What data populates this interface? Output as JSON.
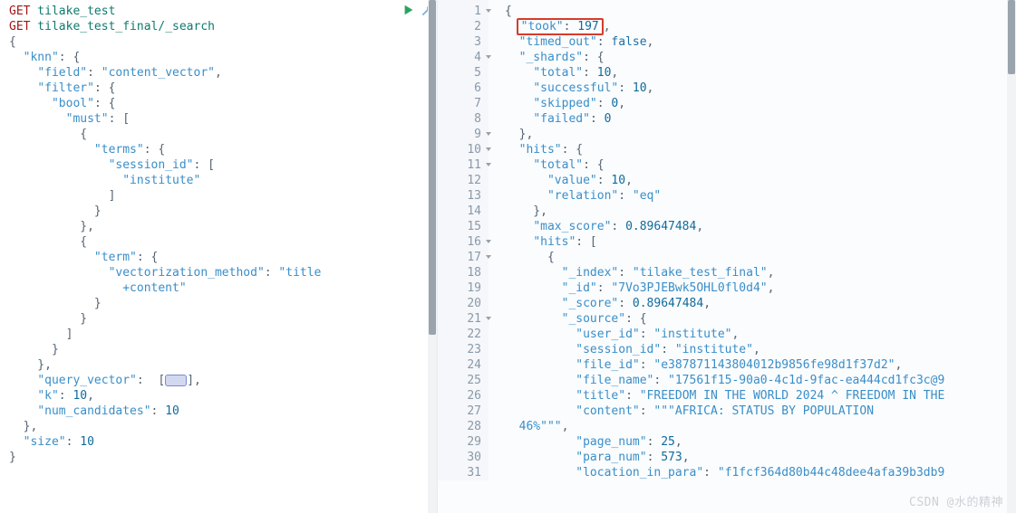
{
  "left": {
    "icons": {
      "play": "play-icon",
      "wrench": "wrench-icon"
    },
    "lines": [
      {
        "t": [
          [
            "GET",
            "m"
          ],
          [
            " tilake_test",
            "k"
          ]
        ]
      },
      {
        "t": [
          [
            "GET",
            "m"
          ],
          [
            " tilake_test_final/_search",
            "k"
          ]
        ]
      },
      {
        "t": [
          [
            "{",
            "p"
          ]
        ]
      },
      {
        "t": [
          [
            "  ",
            "p"
          ],
          [
            "\"knn\"",
            "s"
          ],
          [
            ": {",
            "p"
          ]
        ]
      },
      {
        "t": [
          [
            "    ",
            "p"
          ],
          [
            "\"field\"",
            "s"
          ],
          [
            ": ",
            "p"
          ],
          [
            "\"content_vector\"",
            "s"
          ],
          [
            ",",
            "p"
          ]
        ]
      },
      {
        "t": [
          [
            "    ",
            "p"
          ],
          [
            "\"filter\"",
            "s"
          ],
          [
            ": {",
            "p"
          ]
        ]
      },
      {
        "t": [
          [
            "      ",
            "p"
          ],
          [
            "\"bool\"",
            "s"
          ],
          [
            ": {",
            "p"
          ]
        ]
      },
      {
        "t": [
          [
            "        ",
            "p"
          ],
          [
            "\"must\"",
            "s"
          ],
          [
            ": [",
            "p"
          ]
        ]
      },
      {
        "t": [
          [
            "          {",
            "p"
          ]
        ]
      },
      {
        "t": [
          [
            "            ",
            "p"
          ],
          [
            "\"terms\"",
            "s"
          ],
          [
            ": {",
            "p"
          ]
        ]
      },
      {
        "t": [
          [
            "              ",
            "p"
          ],
          [
            "\"session_id\"",
            "s"
          ],
          [
            ": [",
            "p"
          ]
        ]
      },
      {
        "t": [
          [
            "                ",
            "p"
          ],
          [
            "\"institute\"",
            "s"
          ]
        ]
      },
      {
        "t": [
          [
            "              ]",
            "p"
          ]
        ]
      },
      {
        "t": [
          [
            "            }",
            "p"
          ]
        ]
      },
      {
        "t": [
          [
            "          },",
            "p"
          ]
        ]
      },
      {
        "t": [
          [
            "          {",
            "p"
          ]
        ]
      },
      {
        "t": [
          [
            "            ",
            "p"
          ],
          [
            "\"term\"",
            "s"
          ],
          [
            ": {",
            "p"
          ]
        ]
      },
      {
        "t": [
          [
            "              ",
            "p"
          ],
          [
            "\"vectorization_method\"",
            "s"
          ],
          [
            ": ",
            "p"
          ],
          [
            "\"title",
            "s"
          ]
        ]
      },
      {
        "t": [
          [
            "                +content\"",
            "s"
          ]
        ]
      },
      {
        "t": [
          [
            "            }",
            "p"
          ]
        ]
      },
      {
        "t": [
          [
            "          }",
            "p"
          ]
        ]
      },
      {
        "t": [
          [
            "        ]",
            "p"
          ]
        ]
      },
      {
        "t": [
          [
            "      }",
            "p"
          ]
        ]
      },
      {
        "t": [
          [
            "    },",
            "p"
          ]
        ]
      },
      {
        "t": [
          [
            "    ",
            "p"
          ],
          [
            "\"query_vector\"",
            "s"
          ],
          [
            ":  [",
            "p"
          ],
          [
            "VEC",
            ""
          ],
          [
            "],",
            "p"
          ]
        ]
      },
      {
        "t": [
          [
            "    ",
            "p"
          ],
          [
            "\"k\"",
            "s"
          ],
          [
            ": ",
            "p"
          ],
          [
            "10",
            "n"
          ],
          [
            ",",
            "p"
          ]
        ]
      },
      {
        "t": [
          [
            "    ",
            "p"
          ],
          [
            "\"num_candidates\"",
            "s"
          ],
          [
            ": ",
            "p"
          ],
          [
            "10",
            "n"
          ]
        ]
      },
      {
        "t": [
          [
            "  },",
            "p"
          ]
        ]
      },
      {
        "t": [
          [
            "  ",
            "p"
          ],
          [
            "\"size\"",
            "s"
          ],
          [
            ": ",
            "p"
          ],
          [
            "10",
            "n"
          ]
        ]
      },
      {
        "t": [
          [
            "}",
            "p"
          ]
        ]
      }
    ],
    "cursor_line": 25
  },
  "right": {
    "foldable": [
      1,
      4,
      9,
      10,
      11,
      16,
      17,
      21
    ],
    "highlight_line": 2,
    "lines": [
      {
        "n": 1,
        "t": [
          [
            "{",
            "p"
          ]
        ]
      },
      {
        "n": 2,
        "t": [
          [
            "  ",
            "p"
          ],
          [
            "HLSTART",
            ""
          ],
          [
            "\"took\"",
            "s"
          ],
          [
            ": ",
            "p"
          ],
          [
            "197",
            "n"
          ],
          [
            "HLEND",
            ""
          ],
          [
            ",",
            "p"
          ]
        ]
      },
      {
        "n": 3,
        "t": [
          [
            "  ",
            "p"
          ],
          [
            "\"timed_out\"",
            "s"
          ],
          [
            ": ",
            "p"
          ],
          [
            "false",
            "b"
          ],
          [
            ",",
            "p"
          ]
        ]
      },
      {
        "n": 4,
        "t": [
          [
            "  ",
            "p"
          ],
          [
            "\"_shards\"",
            "s"
          ],
          [
            ": {",
            "p"
          ]
        ]
      },
      {
        "n": 5,
        "t": [
          [
            "    ",
            "p"
          ],
          [
            "\"total\"",
            "s"
          ],
          [
            ": ",
            "p"
          ],
          [
            "10",
            "n"
          ],
          [
            ",",
            "p"
          ]
        ]
      },
      {
        "n": 6,
        "t": [
          [
            "    ",
            "p"
          ],
          [
            "\"successful\"",
            "s"
          ],
          [
            ": ",
            "p"
          ],
          [
            "10",
            "n"
          ],
          [
            ",",
            "p"
          ]
        ]
      },
      {
        "n": 7,
        "t": [
          [
            "    ",
            "p"
          ],
          [
            "\"skipped\"",
            "s"
          ],
          [
            ": ",
            "p"
          ],
          [
            "0",
            "n"
          ],
          [
            ",",
            "p"
          ]
        ]
      },
      {
        "n": 8,
        "t": [
          [
            "    ",
            "p"
          ],
          [
            "\"failed\"",
            "s"
          ],
          [
            ": ",
            "p"
          ],
          [
            "0",
            "n"
          ]
        ]
      },
      {
        "n": 9,
        "t": [
          [
            "  },",
            "p"
          ]
        ]
      },
      {
        "n": 10,
        "t": [
          [
            "  ",
            "p"
          ],
          [
            "\"hits\"",
            "s"
          ],
          [
            ": {",
            "p"
          ]
        ]
      },
      {
        "n": 11,
        "t": [
          [
            "    ",
            "p"
          ],
          [
            "\"total\"",
            "s"
          ],
          [
            ": {",
            "p"
          ]
        ]
      },
      {
        "n": 12,
        "t": [
          [
            "      ",
            "p"
          ],
          [
            "\"value\"",
            "s"
          ],
          [
            ": ",
            "p"
          ],
          [
            "10",
            "n"
          ],
          [
            ",",
            "p"
          ]
        ]
      },
      {
        "n": 13,
        "t": [
          [
            "      ",
            "p"
          ],
          [
            "\"relation\"",
            "s"
          ],
          [
            ": ",
            "p"
          ],
          [
            "\"eq\"",
            "s"
          ]
        ]
      },
      {
        "n": 14,
        "t": [
          [
            "    },",
            "p"
          ]
        ]
      },
      {
        "n": 15,
        "t": [
          [
            "    ",
            "p"
          ],
          [
            "\"max_score\"",
            "s"
          ],
          [
            ": ",
            "p"
          ],
          [
            "0.89647484",
            "n"
          ],
          [
            ",",
            "p"
          ]
        ]
      },
      {
        "n": 16,
        "t": [
          [
            "    ",
            "p"
          ],
          [
            "\"hits\"",
            "s"
          ],
          [
            ": [",
            "p"
          ]
        ]
      },
      {
        "n": 17,
        "t": [
          [
            "      {",
            "p"
          ]
        ]
      },
      {
        "n": 18,
        "t": [
          [
            "        ",
            "p"
          ],
          [
            "\"_index\"",
            "s"
          ],
          [
            ": ",
            "p"
          ],
          [
            "\"tilake_test_final\"",
            "s"
          ],
          [
            ",",
            "p"
          ]
        ]
      },
      {
        "n": 19,
        "t": [
          [
            "        ",
            "p"
          ],
          [
            "\"_id\"",
            "s"
          ],
          [
            ": ",
            "p"
          ],
          [
            "\"7Vo3PJEBwk5OHL0fl0d4\"",
            "s"
          ],
          [
            ",",
            "p"
          ]
        ]
      },
      {
        "n": 20,
        "t": [
          [
            "        ",
            "p"
          ],
          [
            "\"_score\"",
            "s"
          ],
          [
            ": ",
            "p"
          ],
          [
            "0.89647484",
            "n"
          ],
          [
            ",",
            "p"
          ]
        ]
      },
      {
        "n": 21,
        "t": [
          [
            "        ",
            "p"
          ],
          [
            "\"_source\"",
            "s"
          ],
          [
            ": {",
            "p"
          ]
        ]
      },
      {
        "n": 22,
        "t": [
          [
            "          ",
            "p"
          ],
          [
            "\"user_id\"",
            "s"
          ],
          [
            ": ",
            "p"
          ],
          [
            "\"institute\"",
            "s"
          ],
          [
            ",",
            "p"
          ]
        ]
      },
      {
        "n": 23,
        "t": [
          [
            "          ",
            "p"
          ],
          [
            "\"session_id\"",
            "s"
          ],
          [
            ": ",
            "p"
          ],
          [
            "\"institute\"",
            "s"
          ],
          [
            ",",
            "p"
          ]
        ]
      },
      {
        "n": 24,
        "t": [
          [
            "          ",
            "p"
          ],
          [
            "\"file_id\"",
            "s"
          ],
          [
            ": ",
            "p"
          ],
          [
            "\"e387871143804012b9856fe98d1f37d2\"",
            "s"
          ],
          [
            ",",
            "p"
          ]
        ]
      },
      {
        "n": 25,
        "t": [
          [
            "          ",
            "p"
          ],
          [
            "\"file_name\"",
            "s"
          ],
          [
            ": ",
            "p"
          ],
          [
            "\"17561f15-90a0-4c1d-9fac-ea444cd1fc3c@9",
            "s"
          ]
        ]
      },
      {
        "n": 26,
        "t": [
          [
            "          ",
            "p"
          ],
          [
            "\"title\"",
            "s"
          ],
          [
            ": ",
            "p"
          ],
          [
            "\"FREEDOM IN THE WORLD 2024 ^ FREEDOM IN THE",
            "s"
          ]
        ]
      },
      {
        "n": 27,
        "t": [
          [
            "          ",
            "p"
          ],
          [
            "\"content\"",
            "s"
          ],
          [
            ": ",
            "p"
          ],
          [
            "\"\"\"AFRICA: STATUS BY POPULATION  ",
            "s"
          ]
        ]
      },
      {
        "n": 28,
        "t": [
          [
            "  46%\"\"\"",
            "s"
          ],
          [
            ",",
            "p"
          ]
        ]
      },
      {
        "n": 29,
        "t": [
          [
            "          ",
            "p"
          ],
          [
            "\"page_num\"",
            "s"
          ],
          [
            ": ",
            "p"
          ],
          [
            "25",
            "n"
          ],
          [
            ",",
            "p"
          ]
        ]
      },
      {
        "n": 30,
        "t": [
          [
            "          ",
            "p"
          ],
          [
            "\"para_num\"",
            "s"
          ],
          [
            ": ",
            "p"
          ],
          [
            "573",
            "n"
          ],
          [
            ",",
            "p"
          ]
        ]
      },
      {
        "n": 31,
        "t": [
          [
            "          ",
            "p"
          ],
          [
            "\"location_in_para\"",
            "s"
          ],
          [
            ": ",
            "p"
          ],
          [
            "\"f1fcf364d80b44c48dee4afa39b3db9",
            "s"
          ]
        ]
      }
    ]
  },
  "watermark": "CSDN @水的精神"
}
